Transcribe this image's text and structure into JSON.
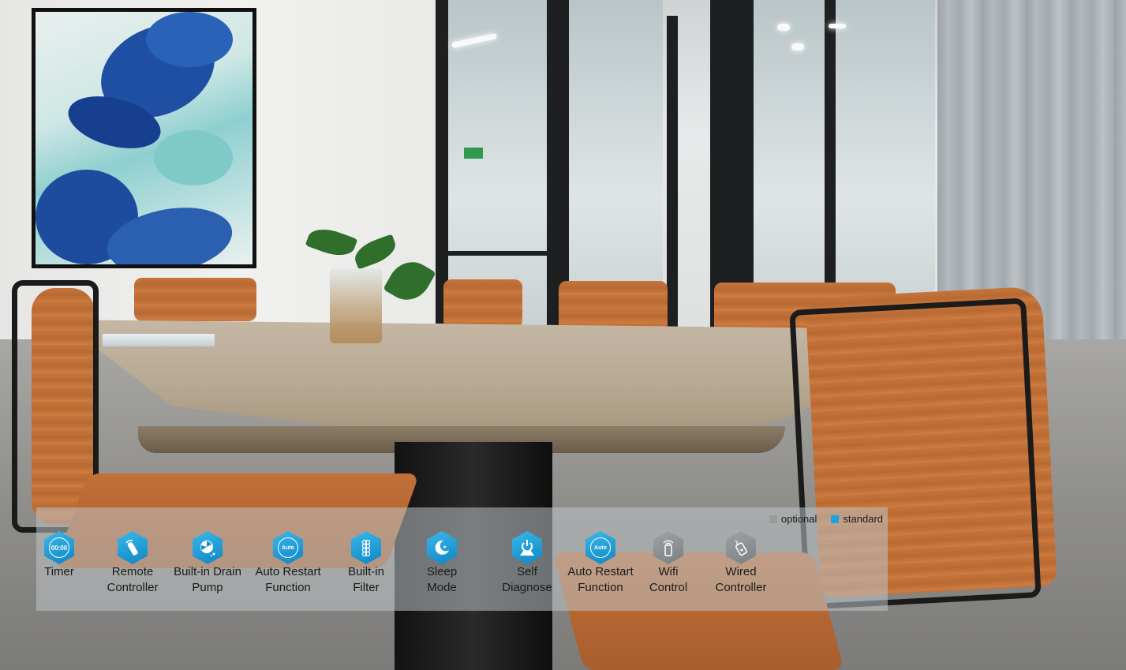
{
  "legend": {
    "optional": {
      "label": "optional",
      "color": "#9b9b9b"
    },
    "standard": {
      "label": "standard",
      "color": "#1aa3e0"
    }
  },
  "features": [
    {
      "label": "Timer",
      "icon": "timer-icon",
      "badge": "00:00",
      "type": "standard"
    },
    {
      "label": "Remote\nController",
      "icon": "remote-controller-icon",
      "type": "standard"
    },
    {
      "label": "Built-in Drain\nPump",
      "icon": "drain-pump-icon",
      "type": "standard"
    },
    {
      "label": "Auto Restart\nFunction",
      "icon": "auto-restart-icon",
      "badge": "Auto",
      "type": "standard"
    },
    {
      "label": "Built-in\nFilter",
      "icon": "filter-icon",
      "type": "standard"
    },
    {
      "label": "Sleep\nMode",
      "icon": "sleep-mode-icon",
      "type": "standard"
    },
    {
      "label": "Self\nDiagnose",
      "icon": "self-diagnose-icon",
      "type": "standard"
    },
    {
      "label": "Auto Restart\nFunction",
      "icon": "auto-restart-icon",
      "badge": "Auto",
      "type": "standard"
    },
    {
      "label": "Wifi\nControl",
      "icon": "wifi-control-icon",
      "type": "optional"
    },
    {
      "label": "Wired\nController",
      "icon": "wired-controller-icon",
      "type": "optional"
    }
  ]
}
